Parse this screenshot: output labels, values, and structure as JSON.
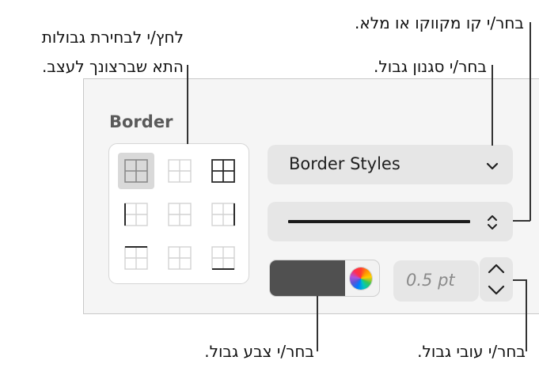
{
  "callouts": {
    "cell_borders": [
      "לחץ/י לבחירת גבולות",
      "התא שברצונך לעצב."
    ],
    "line_type": "בחר/י קו מקווקו או מלא.",
    "border_style": "בחר/י סגנון גבול.",
    "border_color": "בחר/י צבע גבול.",
    "border_width": "בחר/י עובי גבול."
  },
  "panel": {
    "title": "Border",
    "styles_dropdown": {
      "label": "Border Styles"
    },
    "line_dropdown": {
      "selected": "solid"
    },
    "color": {
      "swatch": "#505050"
    },
    "width": {
      "value": "0.5 pt"
    },
    "cell_grid_icons": [
      "all-borders-icon",
      "inside-borders-icon",
      "outside-borders-icon",
      "left-border-icon",
      "inside-vertical-border-icon",
      "right-border-icon",
      "top-border-icon",
      "inside-horizontal-border-icon",
      "bottom-border-icon"
    ],
    "selected_cell_option": "all-borders-icon"
  },
  "colors": {
    "panel_bg": "#f5f5f5",
    "control_bg": "#e6e6e6",
    "selected_bg": "#d9d9d9",
    "title_text": "#5a5a5a"
  }
}
